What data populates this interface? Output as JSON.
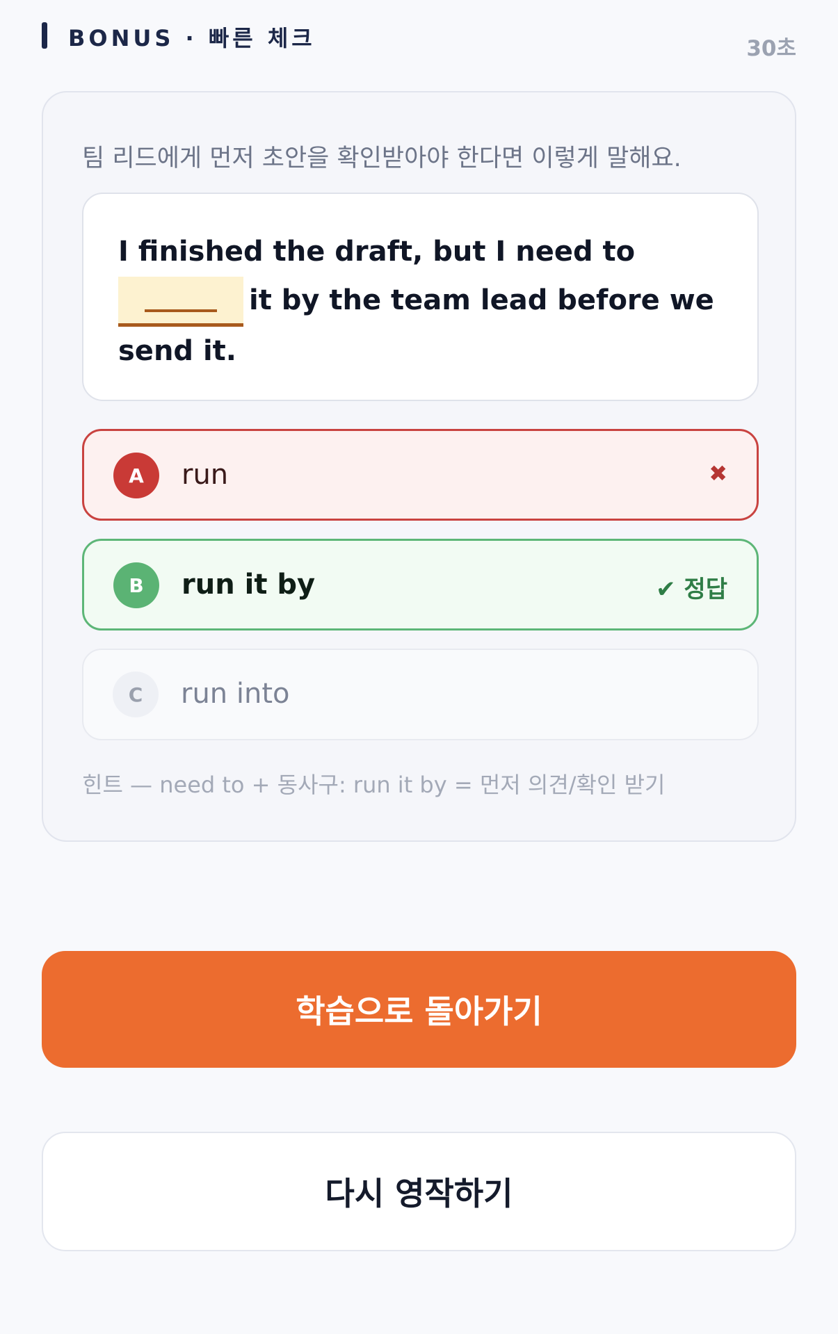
{
  "header": {
    "title": "BONUS · 빠른 체크",
    "timer": "30초"
  },
  "question": {
    "prompt": "팀 리드에게 먼저 초안을 확인받아야 한다면 이렇게 말해요.",
    "sentence_before": "I finished the draft, but I need to",
    "sentence_after": "it by the team lead before we send it."
  },
  "options": [
    {
      "letter": "A",
      "label": "run",
      "state": "wrong",
      "mark": "✖"
    },
    {
      "letter": "B",
      "label": "run it by",
      "state": "correct",
      "mark": "✔ 정답"
    },
    {
      "letter": "C",
      "label": "run into",
      "state": "neutral",
      "mark": ""
    }
  ],
  "hint": "힌트 — need to + 동사구: run it by = 먼저 의견/확인 받기",
  "buttons": {
    "primary": "학습으로 돌아가기",
    "secondary": "다시 영작하기"
  },
  "colors": {
    "accent": "#ec6c2f",
    "wrong": "#c93a36",
    "correct": "#5bb374",
    "blank_fill": "#fdf2d0"
  }
}
